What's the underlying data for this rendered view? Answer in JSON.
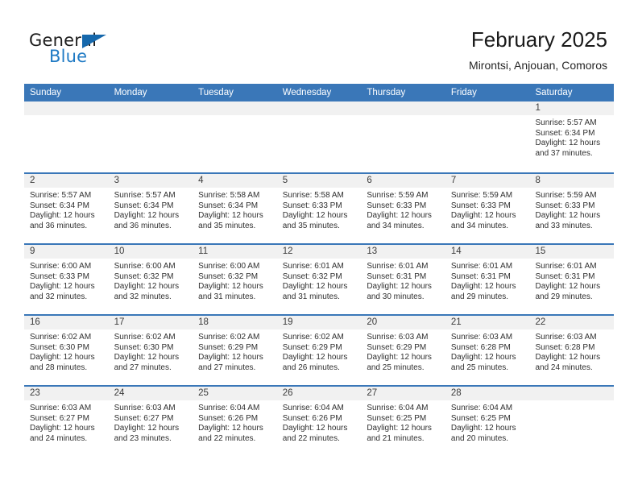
{
  "brand": {
    "name_part1": "General",
    "name_part2": "Blue"
  },
  "header": {
    "title": "February 2025",
    "subtitle": "Mirontsi, Anjouan, Comoros"
  },
  "colors": {
    "header_blue": "#3a77b8",
    "band_gray": "#f1f1f1",
    "logo_blue": "#1f7ac4"
  },
  "weekdays": [
    "Sunday",
    "Monday",
    "Tuesday",
    "Wednesday",
    "Thursday",
    "Friday",
    "Saturday"
  ],
  "weeks": [
    [
      {
        "day": "",
        "empty": true
      },
      {
        "day": "",
        "empty": true
      },
      {
        "day": "",
        "empty": true
      },
      {
        "day": "",
        "empty": true
      },
      {
        "day": "",
        "empty": true
      },
      {
        "day": "",
        "empty": true
      },
      {
        "day": "1",
        "sunrise": "Sunrise: 5:57 AM",
        "sunset": "Sunset: 6:34 PM",
        "daylight": "Daylight: 12 hours and 37 minutes."
      }
    ],
    [
      {
        "day": "2",
        "sunrise": "Sunrise: 5:57 AM",
        "sunset": "Sunset: 6:34 PM",
        "daylight": "Daylight: 12 hours and 36 minutes."
      },
      {
        "day": "3",
        "sunrise": "Sunrise: 5:57 AM",
        "sunset": "Sunset: 6:34 PM",
        "daylight": "Daylight: 12 hours and 36 minutes."
      },
      {
        "day": "4",
        "sunrise": "Sunrise: 5:58 AM",
        "sunset": "Sunset: 6:34 PM",
        "daylight": "Daylight: 12 hours and 35 minutes."
      },
      {
        "day": "5",
        "sunrise": "Sunrise: 5:58 AM",
        "sunset": "Sunset: 6:33 PM",
        "daylight": "Daylight: 12 hours and 35 minutes."
      },
      {
        "day": "6",
        "sunrise": "Sunrise: 5:59 AM",
        "sunset": "Sunset: 6:33 PM",
        "daylight": "Daylight: 12 hours and 34 minutes."
      },
      {
        "day": "7",
        "sunrise": "Sunrise: 5:59 AM",
        "sunset": "Sunset: 6:33 PM",
        "daylight": "Daylight: 12 hours and 34 minutes."
      },
      {
        "day": "8",
        "sunrise": "Sunrise: 5:59 AM",
        "sunset": "Sunset: 6:33 PM",
        "daylight": "Daylight: 12 hours and 33 minutes."
      }
    ],
    [
      {
        "day": "9",
        "sunrise": "Sunrise: 6:00 AM",
        "sunset": "Sunset: 6:33 PM",
        "daylight": "Daylight: 12 hours and 32 minutes."
      },
      {
        "day": "10",
        "sunrise": "Sunrise: 6:00 AM",
        "sunset": "Sunset: 6:32 PM",
        "daylight": "Daylight: 12 hours and 32 minutes."
      },
      {
        "day": "11",
        "sunrise": "Sunrise: 6:00 AM",
        "sunset": "Sunset: 6:32 PM",
        "daylight": "Daylight: 12 hours and 31 minutes."
      },
      {
        "day": "12",
        "sunrise": "Sunrise: 6:01 AM",
        "sunset": "Sunset: 6:32 PM",
        "daylight": "Daylight: 12 hours and 31 minutes."
      },
      {
        "day": "13",
        "sunrise": "Sunrise: 6:01 AM",
        "sunset": "Sunset: 6:31 PM",
        "daylight": "Daylight: 12 hours and 30 minutes."
      },
      {
        "day": "14",
        "sunrise": "Sunrise: 6:01 AM",
        "sunset": "Sunset: 6:31 PM",
        "daylight": "Daylight: 12 hours and 29 minutes."
      },
      {
        "day": "15",
        "sunrise": "Sunrise: 6:01 AM",
        "sunset": "Sunset: 6:31 PM",
        "daylight": "Daylight: 12 hours and 29 minutes."
      }
    ],
    [
      {
        "day": "16",
        "sunrise": "Sunrise: 6:02 AM",
        "sunset": "Sunset: 6:30 PM",
        "daylight": "Daylight: 12 hours and 28 minutes."
      },
      {
        "day": "17",
        "sunrise": "Sunrise: 6:02 AM",
        "sunset": "Sunset: 6:30 PM",
        "daylight": "Daylight: 12 hours and 27 minutes."
      },
      {
        "day": "18",
        "sunrise": "Sunrise: 6:02 AM",
        "sunset": "Sunset: 6:29 PM",
        "daylight": "Daylight: 12 hours and 27 minutes."
      },
      {
        "day": "19",
        "sunrise": "Sunrise: 6:02 AM",
        "sunset": "Sunset: 6:29 PM",
        "daylight": "Daylight: 12 hours and 26 minutes."
      },
      {
        "day": "20",
        "sunrise": "Sunrise: 6:03 AM",
        "sunset": "Sunset: 6:29 PM",
        "daylight": "Daylight: 12 hours and 25 minutes."
      },
      {
        "day": "21",
        "sunrise": "Sunrise: 6:03 AM",
        "sunset": "Sunset: 6:28 PM",
        "daylight": "Daylight: 12 hours and 25 minutes."
      },
      {
        "day": "22",
        "sunrise": "Sunrise: 6:03 AM",
        "sunset": "Sunset: 6:28 PM",
        "daylight": "Daylight: 12 hours and 24 minutes."
      }
    ],
    [
      {
        "day": "23",
        "sunrise": "Sunrise: 6:03 AM",
        "sunset": "Sunset: 6:27 PM",
        "daylight": "Daylight: 12 hours and 24 minutes."
      },
      {
        "day": "24",
        "sunrise": "Sunrise: 6:03 AM",
        "sunset": "Sunset: 6:27 PM",
        "daylight": "Daylight: 12 hours and 23 minutes."
      },
      {
        "day": "25",
        "sunrise": "Sunrise: 6:04 AM",
        "sunset": "Sunset: 6:26 PM",
        "daylight": "Daylight: 12 hours and 22 minutes."
      },
      {
        "day": "26",
        "sunrise": "Sunrise: 6:04 AM",
        "sunset": "Sunset: 6:26 PM",
        "daylight": "Daylight: 12 hours and 22 minutes."
      },
      {
        "day": "27",
        "sunrise": "Sunrise: 6:04 AM",
        "sunset": "Sunset: 6:25 PM",
        "daylight": "Daylight: 12 hours and 21 minutes."
      },
      {
        "day": "28",
        "sunrise": "Sunrise: 6:04 AM",
        "sunset": "Sunset: 6:25 PM",
        "daylight": "Daylight: 12 hours and 20 minutes."
      },
      {
        "day": "",
        "empty": true
      }
    ]
  ]
}
